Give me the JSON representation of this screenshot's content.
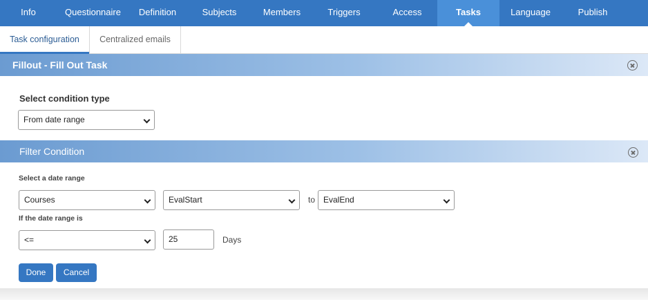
{
  "nav": {
    "items": [
      {
        "label": "Info"
      },
      {
        "label": "Questionnaire"
      },
      {
        "label": "Definition"
      },
      {
        "label": "Subjects"
      },
      {
        "label": "Members"
      },
      {
        "label": "Triggers"
      },
      {
        "label": "Access"
      },
      {
        "label": "Tasks"
      },
      {
        "label": "Language"
      },
      {
        "label": "Publish"
      }
    ],
    "active": "Tasks"
  },
  "subtabs": {
    "items": [
      {
        "label": "Task configuration"
      },
      {
        "label": "Centralized emails"
      }
    ],
    "active": "Task configuration"
  },
  "task_panel": {
    "title": "Fillout - Fill Out Task",
    "condition_type_label": "Select condition type",
    "condition_type_value": "From date range"
  },
  "filter_panel": {
    "title": "Filter Condition",
    "date_range_label": "Select a date range",
    "source_value": "Courses",
    "start_value": "EvalStart",
    "to_label": "to",
    "end_value": "EvalEnd",
    "if_range_label": "If the date range is",
    "operator_value": "<=",
    "amount_value": "25",
    "unit_label": "Days"
  },
  "actions": {
    "done_label": "Done",
    "cancel_label": "Cancel"
  },
  "colors": {
    "nav_bg": "#3577c2",
    "nav_active": "#4a90d9",
    "button_bg": "#3577c2"
  }
}
